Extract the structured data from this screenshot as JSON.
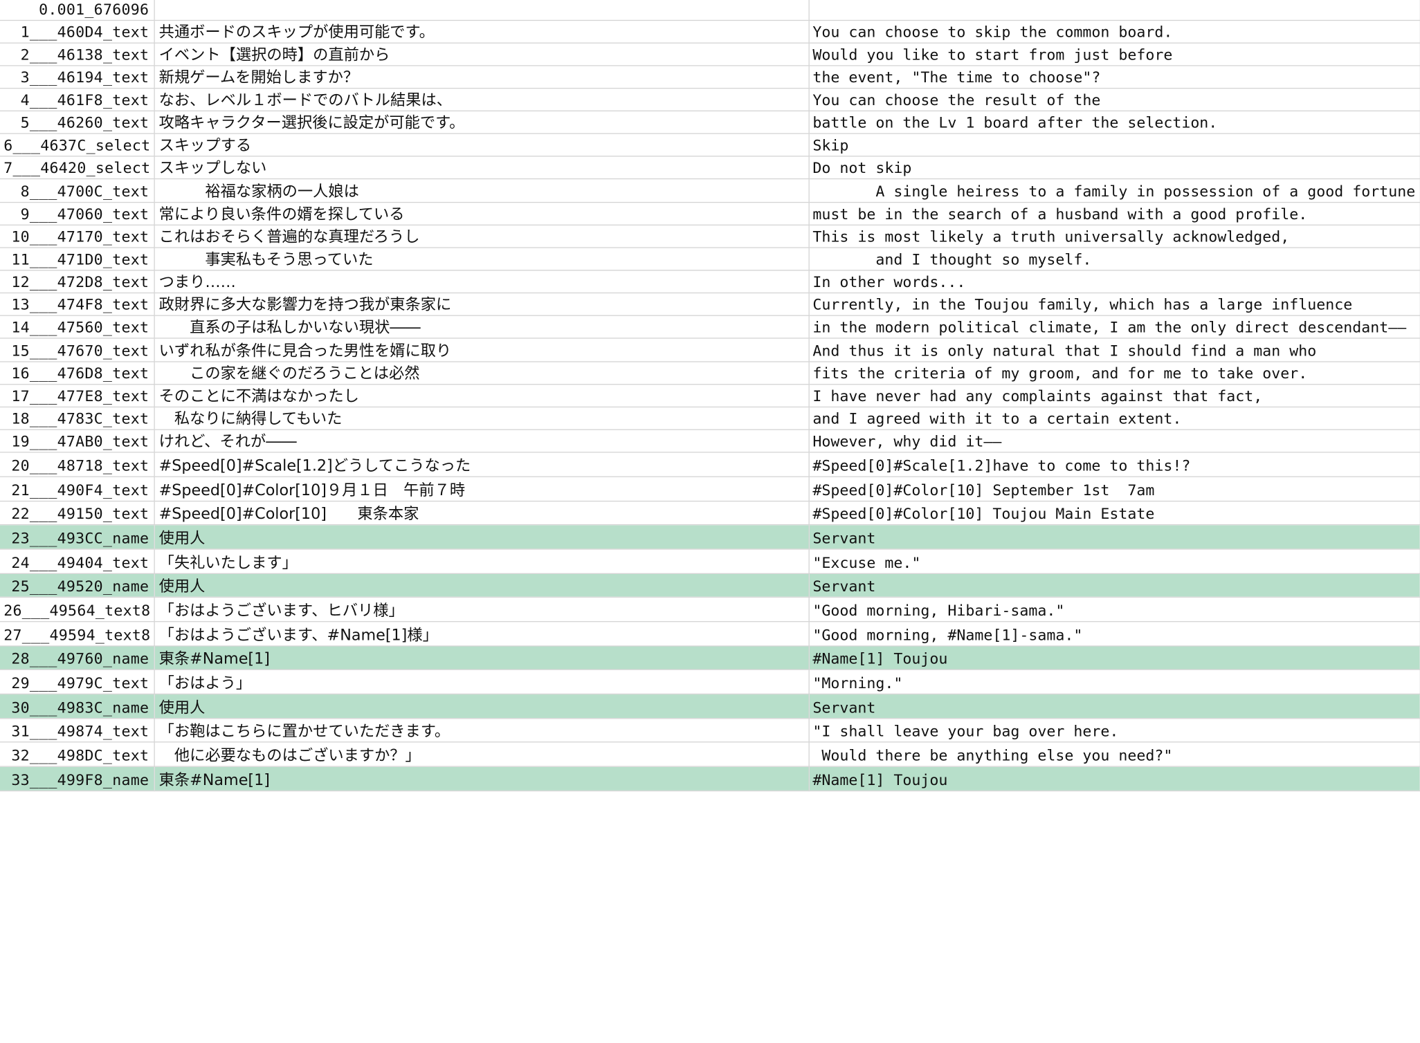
{
  "sheet": {
    "highlight_color": "#b7dfca",
    "rows": [
      {
        "id": "0.001_676096",
        "jp": "",
        "en": "",
        "hl": false
      },
      {
        "id": "1___460D4_text",
        "jp": "共通ボードのスキップが使用可能です。",
        "en": "You can choose to skip the common board.",
        "hl": false
      },
      {
        "id": "2___46138_text",
        "jp": "イベント【選択の時】の直前から",
        "en": "Would you like to start from just before",
        "hl": false
      },
      {
        "id": "3___46194_text",
        "jp": "新規ゲームを開始しますか？",
        "en": "the event, \"The time to choose\"?",
        "hl": false
      },
      {
        "id": "4___461F8_text",
        "jp": "なお、レベル１ボードでのバトル結果は、",
        "en": "You can choose the result of the",
        "hl": false
      },
      {
        "id": "5___46260_text",
        "jp": "攻略キャラクター選択後に設定が可能です。",
        "en": "battle on the Lv 1 board after the selection.",
        "hl": false
      },
      {
        "id": "6___4637C_select",
        "jp": "スキップする",
        "en": "Skip",
        "hl": false
      },
      {
        "id": "7___46420_select",
        "jp": "スキップしない",
        "en": "Do not skip",
        "hl": false
      },
      {
        "id": "8___4700C_text",
        "jp": "　　　裕福な家柄の一人娘は",
        "en": "       A single heiress to a family in possession of a good fortune",
        "hl": false
      },
      {
        "id": "9___47060_text",
        "jp": "常により良い条件の婿を探している",
        "en": "must be in the search of a husband with a good profile.",
        "hl": false
      },
      {
        "id": "10___47170_text",
        "jp": "これはおそらく普遍的な真理だろうし",
        "en": "This is most likely a truth universally acknowledged,",
        "hl": false
      },
      {
        "id": "11___471D0_text",
        "jp": "　　　事実私もそう思っていた",
        "en": "       and I thought so myself.",
        "hl": false
      },
      {
        "id": "12___472D8_text",
        "jp": "つまり……",
        "en": "In other words...",
        "hl": false
      },
      {
        "id": "13___474F8_text",
        "jp": "政財界に多大な影響力を持つ我が東条家に",
        "en": "Currently, in the Toujou family, which has a large influence",
        "hl": false
      },
      {
        "id": "14___47560_text",
        "jp": "　　直系の子は私しかいない現状――",
        "en": "in the modern political climate, I am the only direct descendant――",
        "hl": false
      },
      {
        "id": "15___47670_text",
        "jp": "いずれ私が条件に見合った男性を婿に取り",
        "en": "And thus it is only natural that I should find a man who",
        "hl": false
      },
      {
        "id": "16___476D8_text",
        "jp": "　　この家を継ぐのだろうことは必然",
        "en": "fits the criteria of my groom, and for me to take over.",
        "hl": false
      },
      {
        "id": "17___477E8_text",
        "jp": "そのことに不満はなかったし",
        "en": "I have never had any complaints against that fact,",
        "hl": false
      },
      {
        "id": "18___4783C_text",
        "jp": "　私なりに納得してもいた",
        "en": "and I agreed with it to a certain extent.",
        "hl": false
      },
      {
        "id": "19___47AB0_text",
        "jp": "けれど、それが――",
        "en": "However, why did it――",
        "hl": false
      },
      {
        "id": "20___48718_text",
        "jp": "#Speed[0]#Scale[1.2]どうしてこうなった",
        "en": "#Speed[0]#Scale[1.2]have to come to this!?",
        "hl": false
      },
      {
        "id": "21___490F4_text",
        "jp": "#Speed[0]#Color[10]９月１日　午前７時",
        "en": "#Speed[0]#Color[10] September 1st  7am",
        "hl": false
      },
      {
        "id": "22___49150_text",
        "jp": "#Speed[0]#Color[10]　　東条本家",
        "en": "#Speed[0]#Color[10] Toujou Main Estate",
        "hl": false
      },
      {
        "id": "23___493CC_name",
        "jp": "使用人",
        "en": "Servant",
        "hl": true
      },
      {
        "id": "24___49404_text",
        "jp": "「失礼いたします」",
        "en": "\"Excuse me.\"",
        "hl": false
      },
      {
        "id": "25___49520_name",
        "jp": "使用人",
        "en": "Servant",
        "hl": true
      },
      {
        "id": "26___49564_text8",
        "jp": "「おはようございます、ヒバリ様」",
        "en": "\"Good morning, Hibari-sama.\"",
        "hl": false
      },
      {
        "id": "27___49594_text8",
        "jp": "「おはようございます、#Name[1]様」",
        "en": "\"Good morning, #Name[1]-sama.\"",
        "hl": false
      },
      {
        "id": "28___49760_name",
        "jp": "東条#Name[1]",
        "en": "#Name[1] Toujou",
        "hl": true
      },
      {
        "id": "29___4979C_text",
        "jp": "「おはよう」",
        "en": "\"Morning.\"",
        "hl": false
      },
      {
        "id": "30___4983C_name",
        "jp": "使用人",
        "en": "Servant",
        "hl": true
      },
      {
        "id": "31___49874_text",
        "jp": "「お鞄はこちらに置かせていただきます。",
        "en": "\"I shall leave your bag over here.",
        "hl": false
      },
      {
        "id": "32___498DC_text",
        "jp": "　他に必要なものはございますか？」",
        "en": " Would there be anything else you need?\"",
        "hl": false
      },
      {
        "id": "33___499F8_name",
        "jp": "東条#Name[1]",
        "en": "#Name[1] Toujou",
        "hl": true
      }
    ]
  }
}
